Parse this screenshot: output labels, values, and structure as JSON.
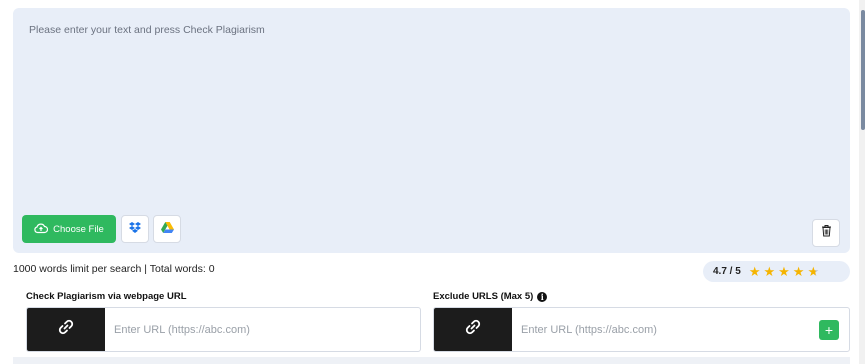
{
  "editor": {
    "placeholder": "Please enter your text and press Check Plagiarism",
    "choose_file_label": "Choose File"
  },
  "status": {
    "limit_text": "1000 words limit per search | Total words: 0"
  },
  "rating": {
    "value_text": "4.7 / 5",
    "score": 4.7,
    "max": 5
  },
  "webpage_url": {
    "label": "Check Plagiarism via webpage URL",
    "placeholder": "Enter URL (https://abc.com)"
  },
  "exclude_urls": {
    "label": "Exclude URLS (Max 5)",
    "placeholder": "Enter URL (https://abc.com)",
    "add_label": "+"
  },
  "colors": {
    "accent_green": "#2fb95f",
    "panel_bg": "#e8eef8",
    "star": "#f5b400",
    "dark_button": "#1c1c1c"
  },
  "icons": [
    "cloud-upload-icon",
    "dropbox-icon",
    "google-drive-icon",
    "trash-icon",
    "link-icon",
    "info-icon",
    "star-icon",
    "plus-icon"
  ]
}
